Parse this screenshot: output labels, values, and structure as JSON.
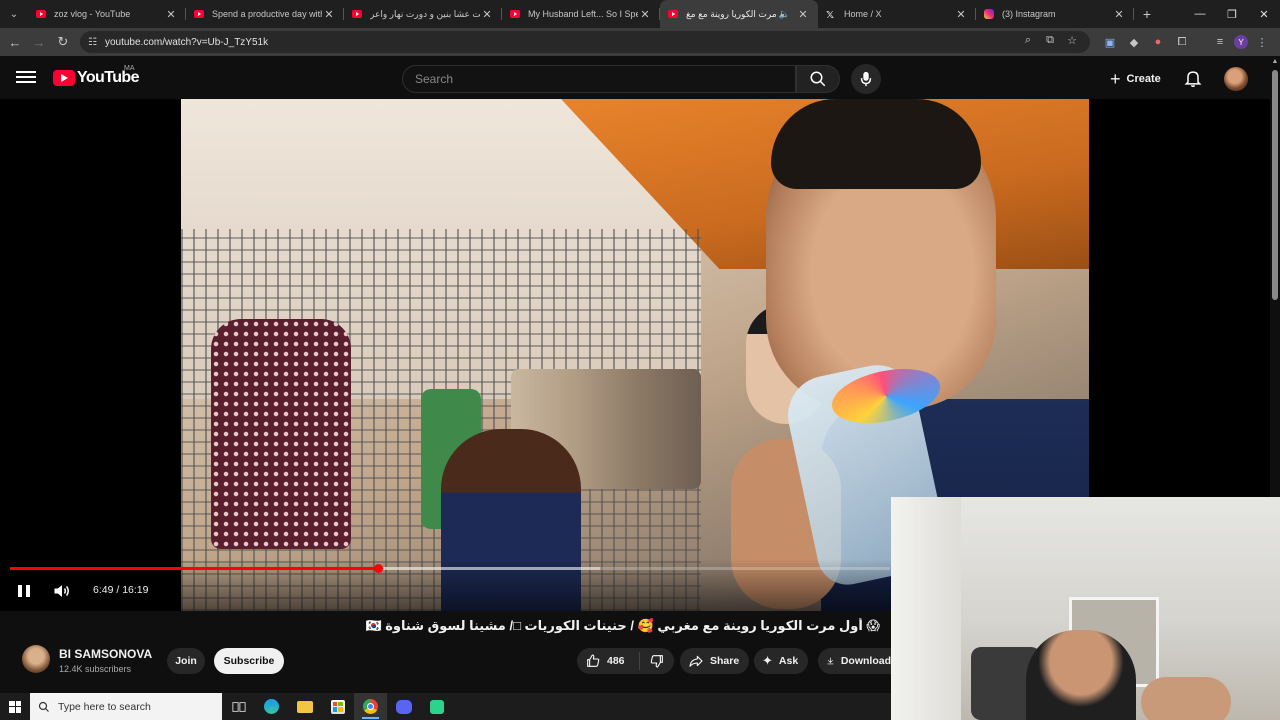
{
  "browser": {
    "tabs": [
      {
        "title": "zoz vlog - YouTube",
        "favicon": "youtube-icon",
        "active": false
      },
      {
        "title": "Spend a productive day with m",
        "favicon": "youtube-icon",
        "active": false
      },
      {
        "title": "طبيت عشا بنين و دورت نهار واعر",
        "favicon": "youtube-icon",
        "active": false
      },
      {
        "title": "My Husband Left... So I Spent a",
        "favicon": "youtube-icon",
        "active": false
      },
      {
        "title": "أول مرت الكوريا روينة مع مغ",
        "favicon": "youtube-icon",
        "active": true,
        "audio": true
      },
      {
        "title": "Home / X",
        "favicon": "x-icon",
        "active": false
      },
      {
        "title": "(3) Instagram",
        "favicon": "instagram-icon",
        "active": false
      }
    ],
    "url": "youtube.com/watch?v=Ub-J_TzY51k",
    "profile_initial": "Y"
  },
  "youtube": {
    "logo_text": "YouTube",
    "country_code": "MA",
    "search_placeholder": "Search",
    "create_label": "Create"
  },
  "player": {
    "time_current": "6:49",
    "time_total": "16:19",
    "time_display": "6:49 / 16:19",
    "progress_played_fraction": 0.418,
    "progress_buffered_fraction": 0.67,
    "state": "playing"
  },
  "video": {
    "title": "😱 أول مرت الكوريا روينة مع مغربي 🥰 / حنينات الكوريات □/ مشينا لسوق شناوة 🇰🇷",
    "channel": "BI SAMSONOVA",
    "subscribers": "12.4K subscribers",
    "join_label": "Join",
    "subscribe_label": "Subscribe",
    "likes": "486",
    "share_label": "Share",
    "ask_label": "Ask",
    "download_label": "Download"
  },
  "taskbar": {
    "search_placeholder": "Type here to search",
    "apps": [
      "task-view-icon",
      "edge-icon",
      "file-explorer-icon",
      "store-icon",
      "chrome-icon",
      "discord-icon",
      "app-icon"
    ]
  },
  "colors": {
    "accent_red": "#ff0000",
    "background": "#0f0f0f"
  }
}
